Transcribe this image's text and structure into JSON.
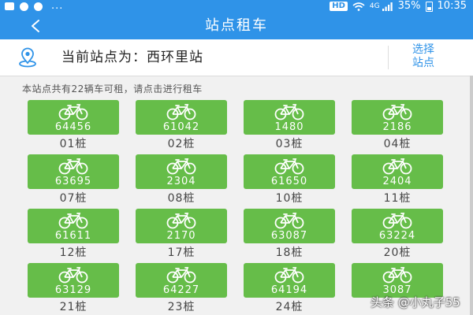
{
  "status_bar": {
    "hd": "HD",
    "network": "4G",
    "battery": "35%",
    "time": "10:35",
    "dots": "..."
  },
  "header": {
    "title": "站点租车",
    "back_icon": "chevron-left-icon"
  },
  "station": {
    "label": "当前站点为：西环里站",
    "select_line1": "选择",
    "select_line2": "站点",
    "icon": "location-pin-icon"
  },
  "info_text": "本站点共有22辆车可租，请点击进行租车",
  "accent_color": "#2f93e8",
  "tile_color": "#66bd49",
  "piles": [
    {
      "bike_id": "64456",
      "pile": "01桩"
    },
    {
      "bike_id": "61042",
      "pile": "02桩"
    },
    {
      "bike_id": "1480",
      "pile": "03桩"
    },
    {
      "bike_id": "2186",
      "pile": "04桩"
    },
    {
      "bike_id": "63695",
      "pile": "07桩"
    },
    {
      "bike_id": "2304",
      "pile": "08桩"
    },
    {
      "bike_id": "61650",
      "pile": "10桩"
    },
    {
      "bike_id": "2404",
      "pile": "11桩"
    },
    {
      "bike_id": "61611",
      "pile": "12桩"
    },
    {
      "bike_id": "2170",
      "pile": "17桩"
    },
    {
      "bike_id": "63087",
      "pile": "18桩"
    },
    {
      "bike_id": "63224",
      "pile": "20桩"
    },
    {
      "bike_id": "63129",
      "pile": "21桩"
    },
    {
      "bike_id": "64227",
      "pile": "23桩"
    },
    {
      "bike_id": "64194",
      "pile": "24桩"
    },
    {
      "bike_id": "3087",
      "pile": ""
    }
  ],
  "watermark": "头条 @小丸子55"
}
